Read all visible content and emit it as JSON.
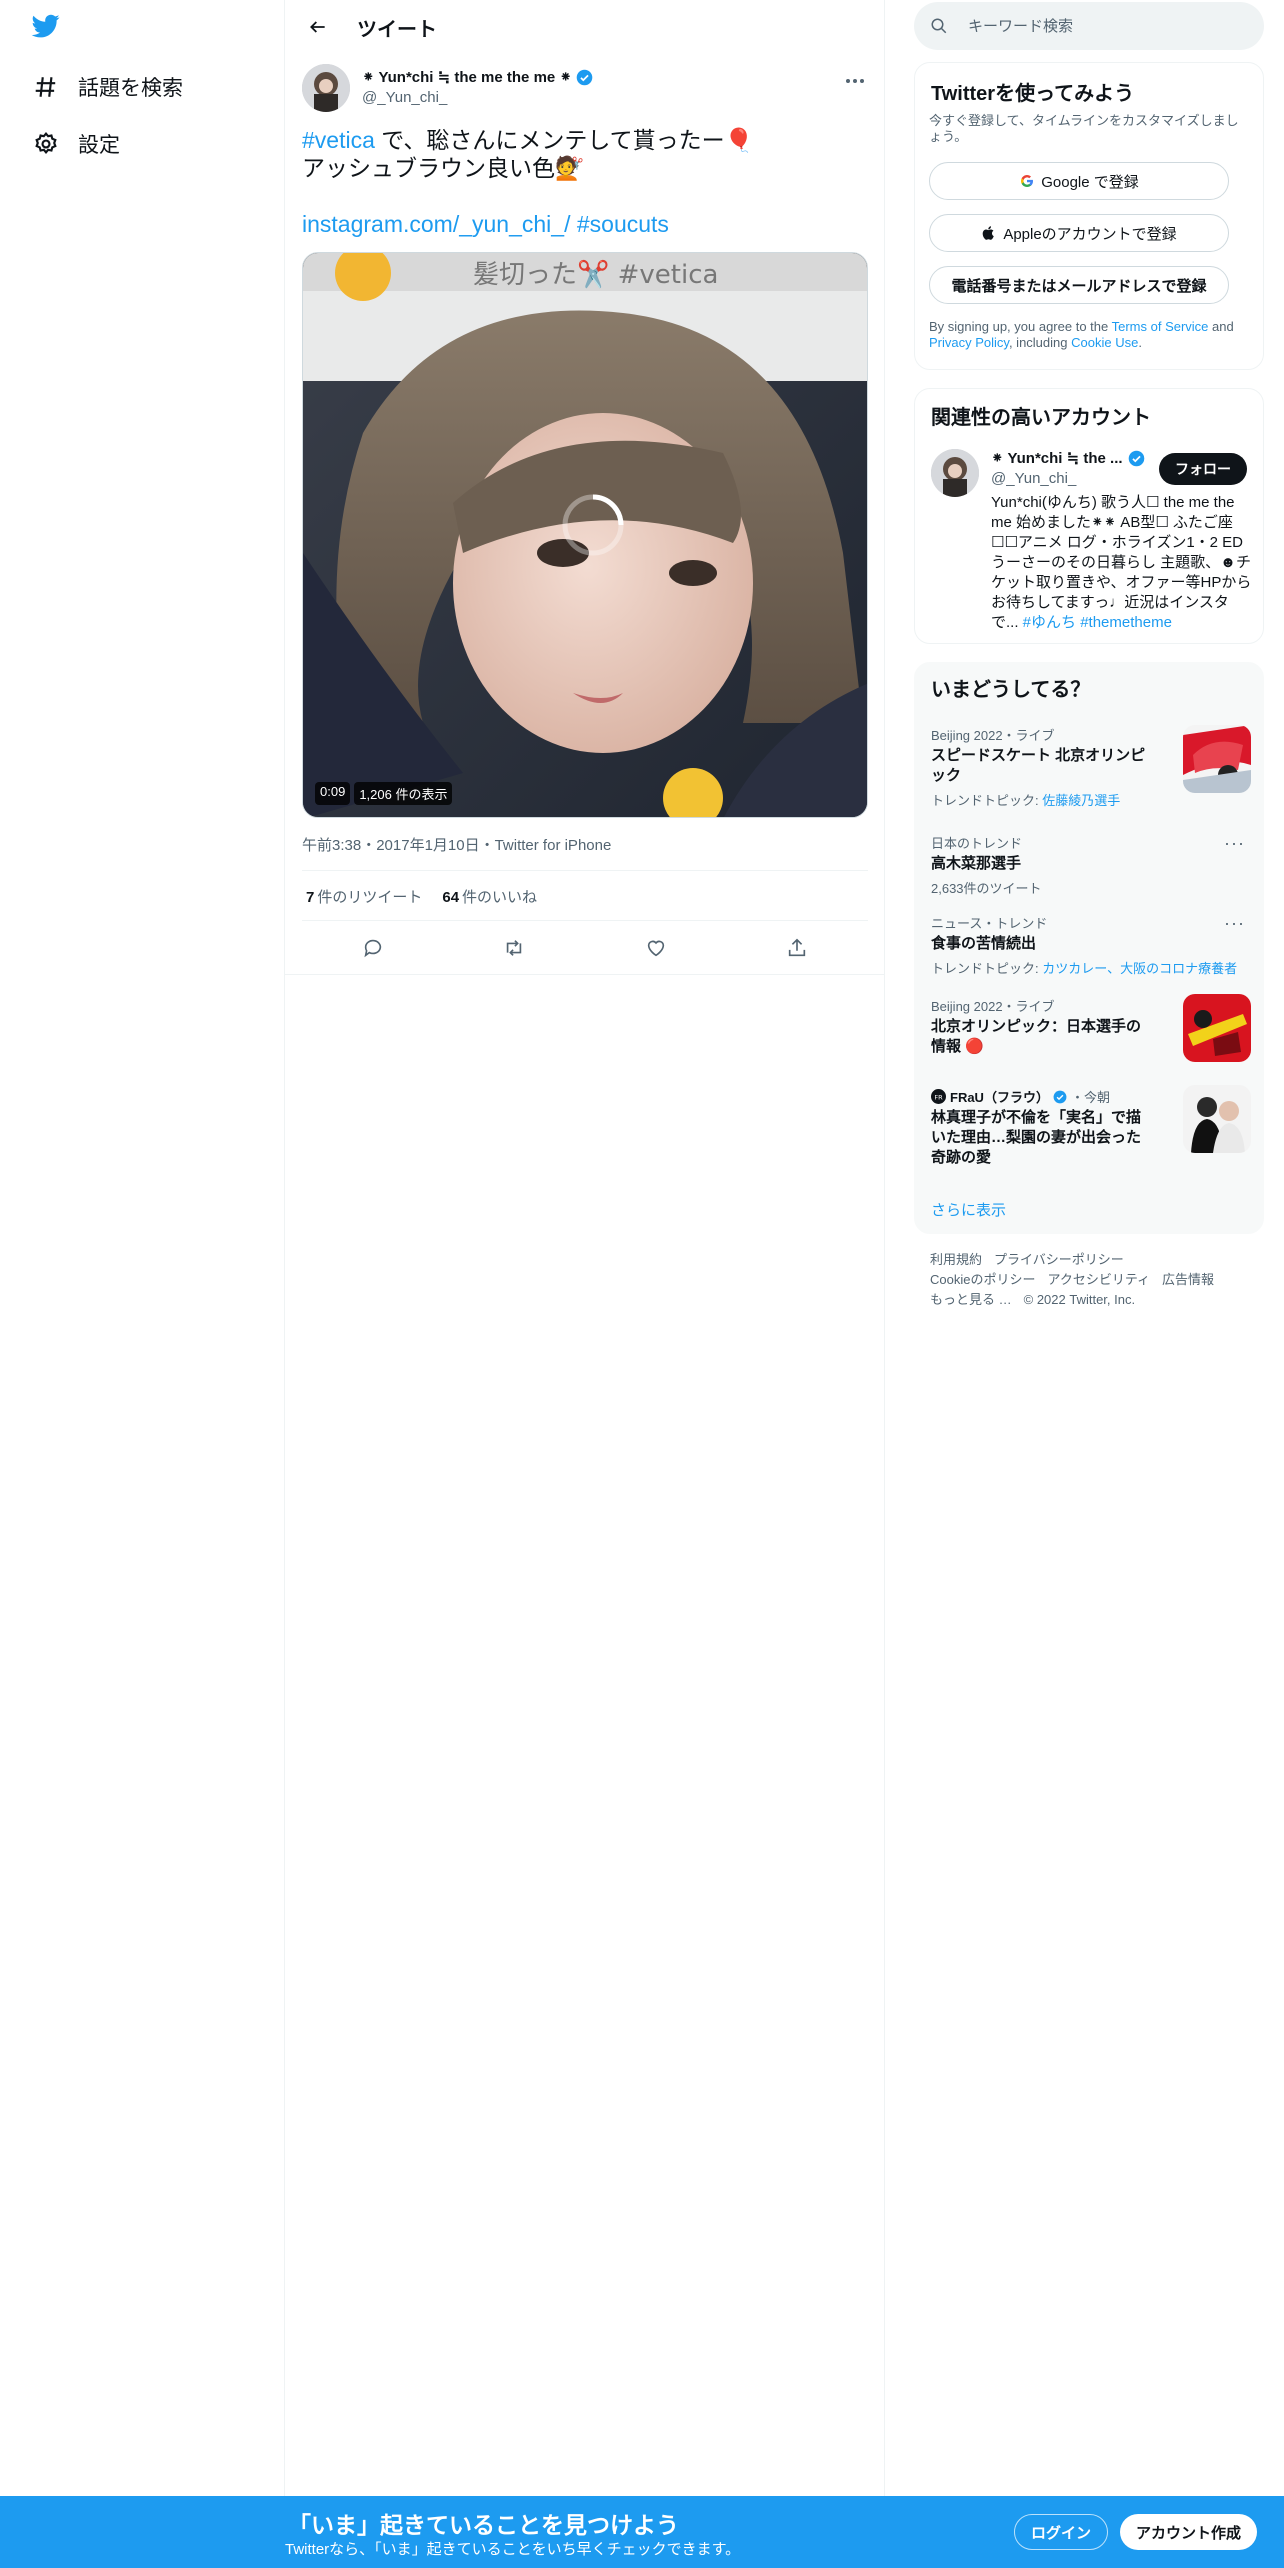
{
  "nav": {
    "explore_label": "話題を検索",
    "settings_label": "設定"
  },
  "header": {
    "title": "ツイート"
  },
  "tweet": {
    "display_name": "⁕ Yun*chi ≒ the me the me ⁕",
    "handle": "@_Yun_chi_",
    "text_hashtag": "#vetica",
    "text_line1": " で、聡さんにメンテして貰ったー🎈",
    "text_line2": "アッシュブラウン良い色💇",
    "text_link": "instagram.com/_yun_chi_/",
    "text_hashtag2": "#soucuts",
    "media_caption": "髪切った✂️ #vetica",
    "video_time": "0:09",
    "video_views": "1,206 件の表示",
    "timestamp": "午前3:38・2017年1月10日・Twitter for iPhone",
    "retweet_count": "7",
    "retweet_label": "件のリツイート",
    "like_count": "64",
    "like_label": "件のいいね"
  },
  "search": {
    "placeholder": "キーワード検索"
  },
  "signup_card": {
    "title": "Twitterを使ってみよう",
    "subtitle": "今すぐ登録して、タイムラインをカスタマイズしましょう。",
    "google_label": "Google で登録",
    "apple_label": "Appleのアカウントで登録",
    "phone_label": "電話番号またはメールアドレスで登録",
    "legal_prefix": "By signing up, you agree to the ",
    "terms": "Terms of Service",
    "legal_and": " and ",
    "privacy": "Privacy Policy",
    "legal_including": ", including ",
    "cookie": "Cookie Use",
    "legal_end": "."
  },
  "related": {
    "title": "関連性の高いアカウント",
    "name": "⁕ Yun*chi ≒ the ...",
    "handle": "@_Yun_chi_",
    "follow_label": "フォロー",
    "bio": "Yun*chi(ゆんち) 歌う人☐ the me the me 始めました⁕⁕ AB型☐ ふたご座☐☐アニメ ログ・ホライズン1・2 ED うーさーのその日暮らし 主題歌、☻チケット取り置きや、オファー等HPからお待ちしてますっ♩近況はインスタで... ",
    "bio_tag1": "#ゆんち",
    "bio_tag2": "#themetheme"
  },
  "trends": {
    "title": "いまどうしてる？",
    "items": [
      {
        "context": "Beijing 2022・ライブ",
        "title": "スピードスケート 北京オリンピック",
        "sub_prefix": "トレンドトピック: ",
        "sub_link": "佐藤綾乃選手"
      },
      {
        "context": "日本のトレンド",
        "title": "高木菜那選手",
        "sub": "2,633件のツイート"
      },
      {
        "context": "ニュース・トレンド",
        "title": "食事の苦情続出",
        "sub_prefix": "トレンドトピック: ",
        "sub_link": "カツカレー、大阪のコロナ療養者"
      },
      {
        "context": "Beijing 2022・ライブ",
        "title": "北京オリンピック：日本選手の情報 🔴"
      },
      {
        "context_source": "FRaU（フラウ）",
        "context_time": "・今朝",
        "title": "林真理子が不倫を「実名」で描いた理由…梨園の妻が出会った奇跡の愛"
      }
    ],
    "show_more": "さらに表示"
  },
  "footer": {
    "terms": "利用規約",
    "privacy": "プライバシーポリシー",
    "cookie": "Cookieのポリシー",
    "accessibility": "アクセシビリティ",
    "ads": "広告情報",
    "more": "もっと見る …",
    "copyright": "© 2022 Twitter, Inc."
  },
  "bottom_bar": {
    "title": "「いま」起きていることを見つけよう",
    "subtitle": "Twitterなら、「いま」起きていることをいち早くチェックできます。",
    "login": "ログイン",
    "signup": "アカウント作成"
  },
  "colors": {
    "brand": "#1d9bf0",
    "text": "#0f1419",
    "muted": "#536471"
  }
}
